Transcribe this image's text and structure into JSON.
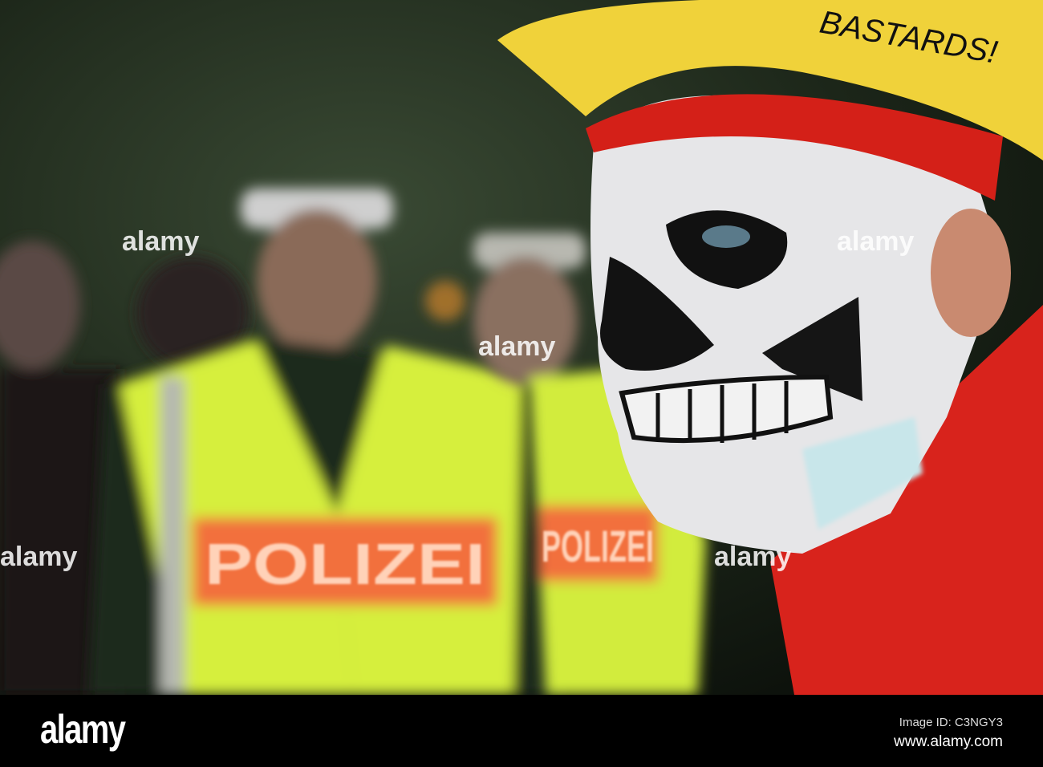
{
  "photo": {
    "helmet_text": "BASTARDS!",
    "vest_text": "POLIZEI",
    "watermark": "alamy",
    "colors": {
      "background": "#1d2a1a",
      "vest": "#d8f03a",
      "vest_band": "#f26a3a",
      "helmet": "#f2d43a",
      "bandana": "#d42018",
      "face_paint": "#e8e8ea"
    }
  },
  "footer": {
    "logo": "alamy",
    "image_id": "Image ID: C3NGY3",
    "url": "www.alamy.com"
  }
}
